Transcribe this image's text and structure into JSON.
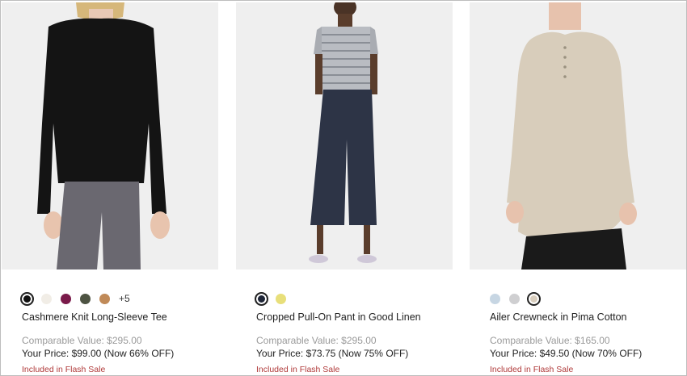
{
  "products": [
    {
      "name": "Cashmere Knit Long-Sleeve Tee",
      "comparable": "Comparable Value: $295.00",
      "price": "Your Price: $99.00 (Now 66% OFF)",
      "flash": "Included in Flash Sale",
      "more_colors": "+5",
      "swatches": [
        "#111111",
        "#f1ede6",
        "#7a1a4a",
        "#4d5342",
        "#c08a58"
      ],
      "image": "black-cashmere-tee-photo"
    },
    {
      "name": "Cropped Pull-On Pant in Good Linen",
      "comparable": "Comparable Value: $295.00",
      "price": "Your Price: $73.75 (Now 75% OFF)",
      "flash": "Included in Flash Sale",
      "swatches": [
        "#1f2638",
        "#e8df7a"
      ],
      "image": "navy-linen-pant-photo"
    },
    {
      "name": "Ailer Crewneck in Pima Cotton",
      "comparable": "Comparable Value: $165.00",
      "price": "Your Price: $49.50 (Now 70% OFF)",
      "flash": "Included in Flash Sale",
      "swatches": [
        "#c7d6e3",
        "#cfcfd1",
        "#d8cdbd"
      ],
      "image": "oatmeal-henley-photo"
    }
  ]
}
